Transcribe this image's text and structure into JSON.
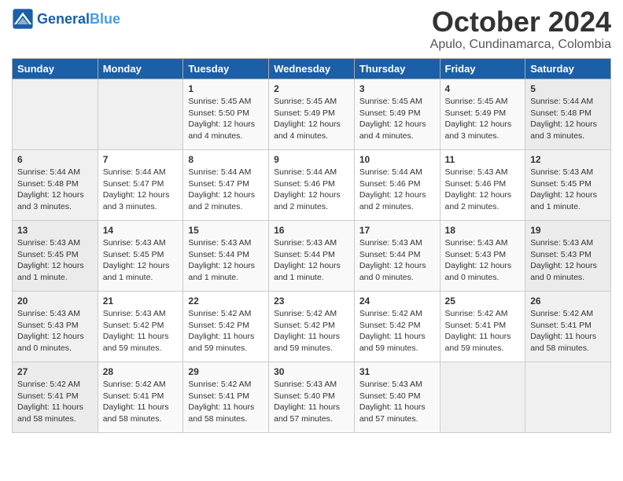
{
  "header": {
    "logo_general": "General",
    "logo_blue": "Blue",
    "title": "October 2024",
    "subtitle": "Apulo, Cundinamarca, Colombia"
  },
  "days_of_week": [
    "Sunday",
    "Monday",
    "Tuesday",
    "Wednesday",
    "Thursday",
    "Friday",
    "Saturday"
  ],
  "weeks": [
    [
      {
        "day": "",
        "content": ""
      },
      {
        "day": "",
        "content": ""
      },
      {
        "day": "1",
        "content": "Sunrise: 5:45 AM\nSunset: 5:50 PM\nDaylight: 12 hours\nand 4 minutes."
      },
      {
        "day": "2",
        "content": "Sunrise: 5:45 AM\nSunset: 5:49 PM\nDaylight: 12 hours\nand 4 minutes."
      },
      {
        "day": "3",
        "content": "Sunrise: 5:45 AM\nSunset: 5:49 PM\nDaylight: 12 hours\nand 4 minutes."
      },
      {
        "day": "4",
        "content": "Sunrise: 5:45 AM\nSunset: 5:49 PM\nDaylight: 12 hours\nand 3 minutes."
      },
      {
        "day": "5",
        "content": "Sunrise: 5:44 AM\nSunset: 5:48 PM\nDaylight: 12 hours\nand 3 minutes."
      }
    ],
    [
      {
        "day": "6",
        "content": "Sunrise: 5:44 AM\nSunset: 5:48 PM\nDaylight: 12 hours\nand 3 minutes."
      },
      {
        "day": "7",
        "content": "Sunrise: 5:44 AM\nSunset: 5:47 PM\nDaylight: 12 hours\nand 3 minutes."
      },
      {
        "day": "8",
        "content": "Sunrise: 5:44 AM\nSunset: 5:47 PM\nDaylight: 12 hours\nand 2 minutes."
      },
      {
        "day": "9",
        "content": "Sunrise: 5:44 AM\nSunset: 5:46 PM\nDaylight: 12 hours\nand 2 minutes."
      },
      {
        "day": "10",
        "content": "Sunrise: 5:44 AM\nSunset: 5:46 PM\nDaylight: 12 hours\nand 2 minutes."
      },
      {
        "day": "11",
        "content": "Sunrise: 5:43 AM\nSunset: 5:46 PM\nDaylight: 12 hours\nand 2 minutes."
      },
      {
        "day": "12",
        "content": "Sunrise: 5:43 AM\nSunset: 5:45 PM\nDaylight: 12 hours\nand 1 minute."
      }
    ],
    [
      {
        "day": "13",
        "content": "Sunrise: 5:43 AM\nSunset: 5:45 PM\nDaylight: 12 hours\nand 1 minute."
      },
      {
        "day": "14",
        "content": "Sunrise: 5:43 AM\nSunset: 5:45 PM\nDaylight: 12 hours\nand 1 minute."
      },
      {
        "day": "15",
        "content": "Sunrise: 5:43 AM\nSunset: 5:44 PM\nDaylight: 12 hours\nand 1 minute."
      },
      {
        "day": "16",
        "content": "Sunrise: 5:43 AM\nSunset: 5:44 PM\nDaylight: 12 hours\nand 1 minute."
      },
      {
        "day": "17",
        "content": "Sunrise: 5:43 AM\nSunset: 5:44 PM\nDaylight: 12 hours\nand 0 minutes."
      },
      {
        "day": "18",
        "content": "Sunrise: 5:43 AM\nSunset: 5:43 PM\nDaylight: 12 hours\nand 0 minutes."
      },
      {
        "day": "19",
        "content": "Sunrise: 5:43 AM\nSunset: 5:43 PM\nDaylight: 12 hours\nand 0 minutes."
      }
    ],
    [
      {
        "day": "20",
        "content": "Sunrise: 5:43 AM\nSunset: 5:43 PM\nDaylight: 12 hours\nand 0 minutes."
      },
      {
        "day": "21",
        "content": "Sunrise: 5:43 AM\nSunset: 5:42 PM\nDaylight: 11 hours\nand 59 minutes."
      },
      {
        "day": "22",
        "content": "Sunrise: 5:42 AM\nSunset: 5:42 PM\nDaylight: 11 hours\nand 59 minutes."
      },
      {
        "day": "23",
        "content": "Sunrise: 5:42 AM\nSunset: 5:42 PM\nDaylight: 11 hours\nand 59 minutes."
      },
      {
        "day": "24",
        "content": "Sunrise: 5:42 AM\nSunset: 5:42 PM\nDaylight: 11 hours\nand 59 minutes."
      },
      {
        "day": "25",
        "content": "Sunrise: 5:42 AM\nSunset: 5:41 PM\nDaylight: 11 hours\nand 59 minutes."
      },
      {
        "day": "26",
        "content": "Sunrise: 5:42 AM\nSunset: 5:41 PM\nDaylight: 11 hours\nand 58 minutes."
      }
    ],
    [
      {
        "day": "27",
        "content": "Sunrise: 5:42 AM\nSunset: 5:41 PM\nDaylight: 11 hours\nand 58 minutes."
      },
      {
        "day": "28",
        "content": "Sunrise: 5:42 AM\nSunset: 5:41 PM\nDaylight: 11 hours\nand 58 minutes."
      },
      {
        "day": "29",
        "content": "Sunrise: 5:42 AM\nSunset: 5:41 PM\nDaylight: 11 hours\nand 58 minutes."
      },
      {
        "day": "30",
        "content": "Sunrise: 5:43 AM\nSunset: 5:40 PM\nDaylight: 11 hours\nand 57 minutes."
      },
      {
        "day": "31",
        "content": "Sunrise: 5:43 AM\nSunset: 5:40 PM\nDaylight: 11 hours\nand 57 minutes."
      },
      {
        "day": "",
        "content": ""
      },
      {
        "day": "",
        "content": ""
      }
    ]
  ]
}
